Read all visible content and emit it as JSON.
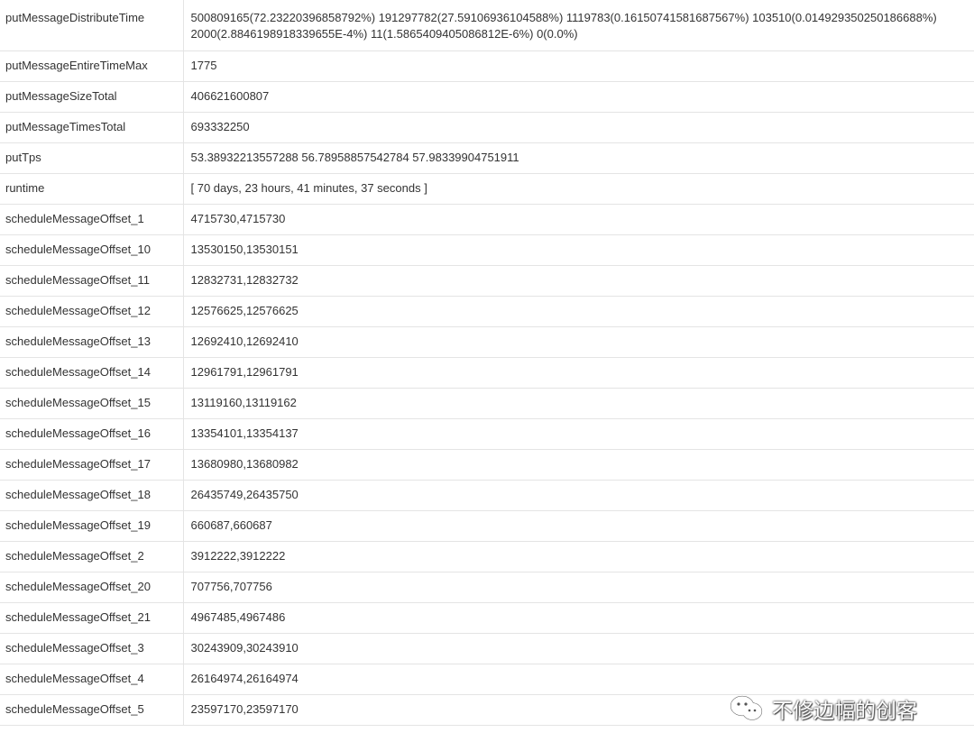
{
  "rows": [
    {
      "key": "putMessageDistributeTime",
      "value": "500809165(72.23220396858792%) 191297782(27.59106936104588%) 1119783(0.16150741581687567%) 103510(0.014929350250186688%) 2000(2.8846198918339655E-4%) 11(1.5865409405086812E-6%) 0(0.0%)"
    },
    {
      "key": "putMessageEntireTimeMax",
      "value": "1775"
    },
    {
      "key": "putMessageSizeTotal",
      "value": "406621600807"
    },
    {
      "key": "putMessageTimesTotal",
      "value": "693332250"
    },
    {
      "key": "putTps",
      "value": "53.38932213557288 56.78958857542784 57.98339904751911"
    },
    {
      "key": "runtime",
      "value": "[ 70 days, 23 hours, 41 minutes, 37 seconds ]"
    },
    {
      "key": "scheduleMessageOffset_1",
      "value": "4715730,4715730"
    },
    {
      "key": "scheduleMessageOffset_10",
      "value": "13530150,13530151"
    },
    {
      "key": "scheduleMessageOffset_11",
      "value": "12832731,12832732"
    },
    {
      "key": "scheduleMessageOffset_12",
      "value": "12576625,12576625"
    },
    {
      "key": "scheduleMessageOffset_13",
      "value": "12692410,12692410"
    },
    {
      "key": "scheduleMessageOffset_14",
      "value": "12961791,12961791"
    },
    {
      "key": "scheduleMessageOffset_15",
      "value": "13119160,13119162"
    },
    {
      "key": "scheduleMessageOffset_16",
      "value": "13354101,13354137"
    },
    {
      "key": "scheduleMessageOffset_17",
      "value": "13680980,13680982"
    },
    {
      "key": "scheduleMessageOffset_18",
      "value": "26435749,26435750"
    },
    {
      "key": "scheduleMessageOffset_19",
      "value": "660687,660687"
    },
    {
      "key": "scheduleMessageOffset_2",
      "value": "3912222,3912222"
    },
    {
      "key": "scheduleMessageOffset_20",
      "value": "707756,707756"
    },
    {
      "key": "scheduleMessageOffset_21",
      "value": "4967485,4967486"
    },
    {
      "key": "scheduleMessageOffset_3",
      "value": "30243909,30243910"
    },
    {
      "key": "scheduleMessageOffset_4",
      "value": "26164974,26164974"
    },
    {
      "key": "scheduleMessageOffset_5",
      "value": "23597170,23597170"
    }
  ],
  "watermark": {
    "text": "不修边幅的创客",
    "icon": "wechat-logo-icon"
  },
  "colors": {
    "border": "#e4e4e4",
    "text": "#333333",
    "background": "#ffffff"
  }
}
